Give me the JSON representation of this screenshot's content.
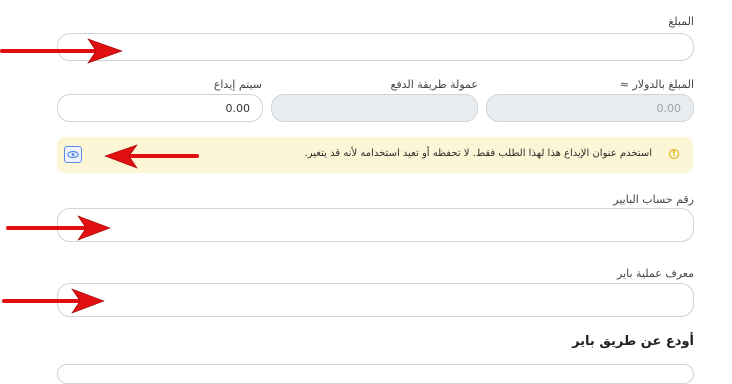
{
  "form": {
    "amount": {
      "label": "المبلغ",
      "value": ""
    },
    "deposit_system": {
      "label": "سيتم إيداع",
      "value": "0.00"
    },
    "payment_fee": {
      "label": "عمولة طريقة الدفع",
      "value": ""
    },
    "usd_amount": {
      "label": "المبلغ بالدولار ≈",
      "value": "0.00"
    },
    "notice": {
      "text": "استخدم عنوان الإيداع هذا لهذا الطلب فقط. لا تحفظه أو تعيد استخدامه لأنه قد يتغير.",
      "warn_symbol": "!"
    },
    "payer_account": {
      "label": "رقم حساب البايير",
      "value": ""
    },
    "payer_transaction": {
      "label": "معرف عملية باير",
      "value": ""
    },
    "section_title": "أودع عن طريق باير"
  },
  "colors": {
    "arrow": "#e01010",
    "notice_bg": "#fdf6d6",
    "warn": "#e0a800",
    "eye": "#5b8de8"
  },
  "icons": [
    "warning-icon",
    "eye-icon",
    "red-arrow"
  ]
}
